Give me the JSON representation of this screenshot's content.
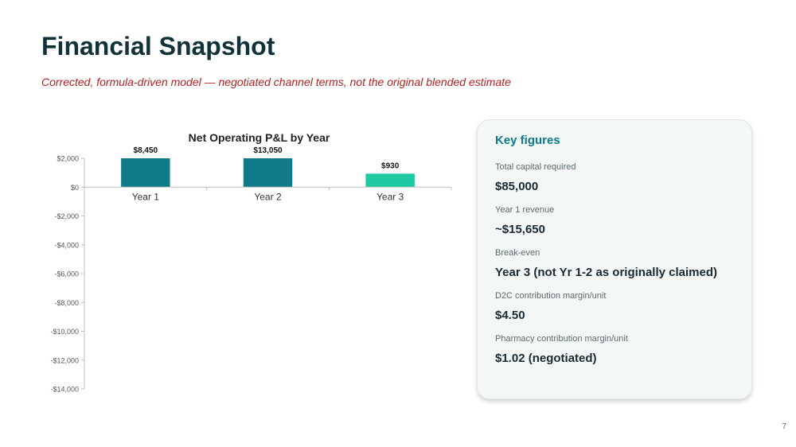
{
  "slide": {
    "title": "Financial Snapshot",
    "subtitle": "Corrected, formula-driven model — negotiated channel terms, not the original blended estimate",
    "page_number": "7"
  },
  "key_figures": {
    "heading": "Key figures",
    "items": [
      {
        "label": "Total capital required",
        "value": "$85,000"
      },
      {
        "label": "Year 1 revenue",
        "value": "~$15,650"
      },
      {
        "label": "Break-even",
        "value": "Year 3 (not Yr 1-2 as originally claimed)"
      },
      {
        "label": "D2C contribution margin/unit",
        "value": "$4.50"
      },
      {
        "label": "Pharmacy contribution margin/unit",
        "value": "$1.02 (negotiated)"
      }
    ]
  },
  "chart_data": {
    "type": "bar",
    "title": "Net Operating P&L by Year",
    "categories": [
      "Year 1",
      "Year 2",
      "Year 3"
    ],
    "values": [
      8450,
      13050,
      930
    ],
    "data_labels": [
      "$8,450",
      "$13,050",
      "$930"
    ],
    "yticks": [
      2000,
      0,
      -2000,
      -4000,
      -6000,
      -8000,
      -10000,
      -12000,
      -14000
    ],
    "ytick_labels": [
      "$2,000",
      "$0",
      "-$2,000",
      "-$4,000",
      "-$6,000",
      "-$8,000",
      "-$10,000",
      "-$12,000",
      "-$14,000"
    ],
    "ylim": [
      -14000,
      2000
    ],
    "grid": false,
    "legend": "none",
    "bar_colors": [
      "#117a8b",
      "#117a8b",
      "#1cc9a0"
    ]
  }
}
